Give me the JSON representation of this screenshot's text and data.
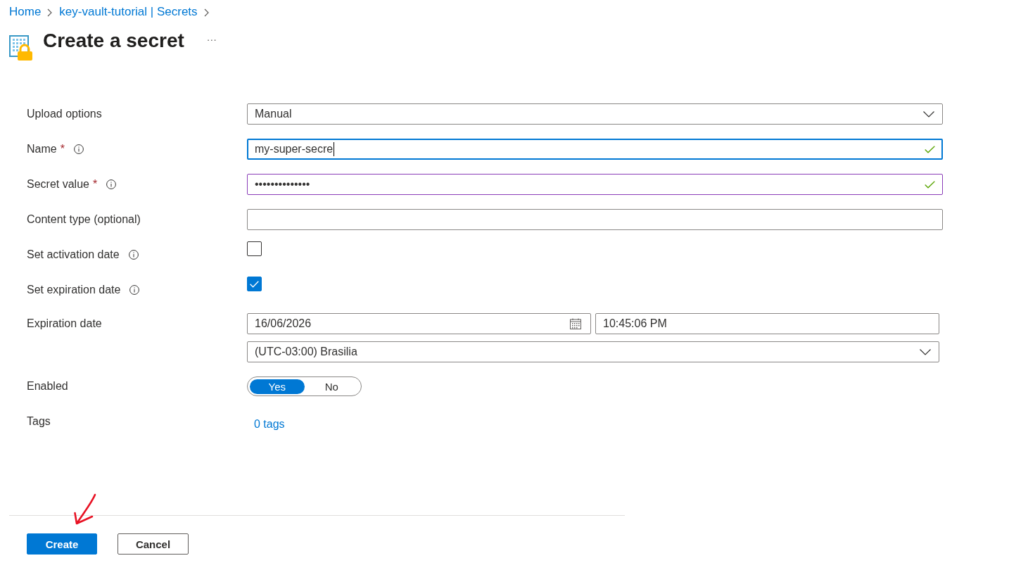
{
  "breadcrumb": [
    {
      "label": "Home"
    },
    {
      "label": "key-vault-tutorial | Secrets"
    }
  ],
  "header": {
    "title": "Create a secret",
    "more_button": "···"
  },
  "form": {
    "fields": [
      {
        "kind": "select",
        "label": "Upload options",
        "value": "Manual"
      },
      {
        "kind": "text",
        "label": "Name",
        "required_mark": "*",
        "info": true,
        "value": "my-super-secre",
        "focused": true,
        "highlighted": false,
        "valid": true
      },
      {
        "kind": "password",
        "label": "Secret value",
        "required_mark": "*",
        "info": true,
        "value": "••••••••••••••",
        "focused": false,
        "highlighted": true,
        "valid": true
      },
      {
        "kind": "text",
        "label": "Content type (optional)",
        "focused": false,
        "highlighted": false
      },
      {
        "kind": "checkbox",
        "label": "Set activation date",
        "info": true,
        "checked": false
      },
      {
        "kind": "checkbox",
        "label": "Set expiration date",
        "info": true,
        "checked": true
      },
      {
        "kind": "datetime",
        "label": "Expiration date",
        "date": "16/06/2026",
        "time": "10:45:06 PM",
        "timezone": "(UTC-03:00) Brasilia"
      },
      {
        "kind": "toggle",
        "label": "Enabled",
        "options": [
          {
            "label": "Yes",
            "selected": true
          },
          {
            "label": "No",
            "selected": false
          }
        ]
      },
      {
        "kind": "link",
        "label": "Tags",
        "value": "0 tags"
      }
    ]
  },
  "footer": {
    "buttons": [
      {
        "kind": "primary",
        "label": "Create"
      },
      {
        "kind": "secondary",
        "label": "Cancel"
      }
    ]
  }
}
